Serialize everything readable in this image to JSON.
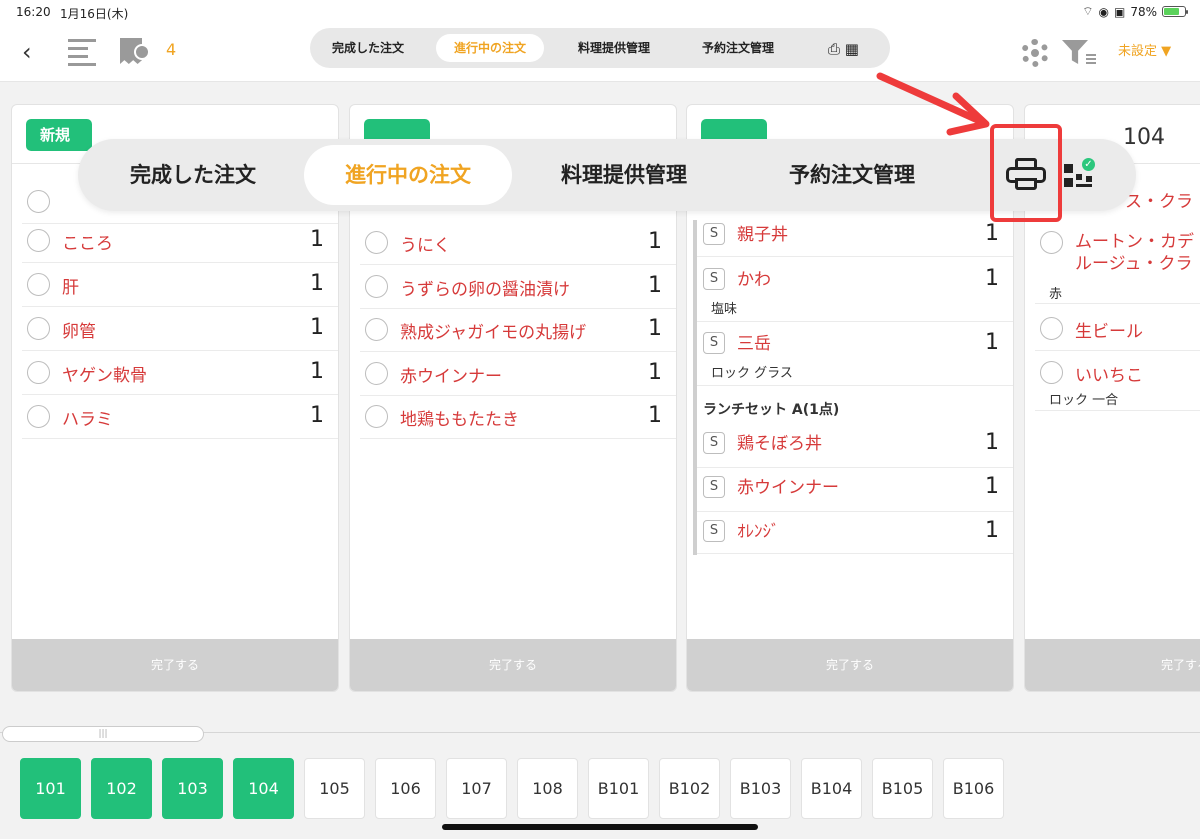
{
  "status": {
    "time": "16:20",
    "date": "1月16日(木)",
    "battery": "78%"
  },
  "header": {
    "back_icon": "chevron-left-icon",
    "badge_count": "4",
    "tabs": [
      "完成した注文",
      "進行中の注文",
      "料理提供管理",
      "予約注文管理"
    ],
    "active_tab": "進行中の注文",
    "unset_label": "未設定"
  },
  "overlay": {
    "tabs": [
      "完成した注文",
      "進行中の注文",
      "料理提供管理",
      "予約注文管理"
    ]
  },
  "columns": [
    {
      "badge": "新規",
      "items": [
        {
          "name": "こころ",
          "qty": "1"
        },
        {
          "name": "肝",
          "qty": "1"
        },
        {
          "name": "卵管",
          "qty": "1"
        },
        {
          "name": "ヤゲン軟骨",
          "qty": "1"
        },
        {
          "name": "ハラミ",
          "qty": "1"
        }
      ],
      "done_label": "完了する"
    },
    {
      "items": [
        {
          "name": "うにく",
          "qty": "1"
        },
        {
          "name": "うずらの卵の醤油漬け",
          "qty": "1"
        },
        {
          "name": "熟成ジャガイモの丸揚げ",
          "qty": "1"
        },
        {
          "name": "赤ウインナー",
          "qty": "1"
        },
        {
          "name": "地鶏ももたたき",
          "qty": "1"
        }
      ],
      "done_label": "完了する"
    },
    {
      "items": [
        {
          "name": "親子丼",
          "qty": "1",
          "sub": ""
        },
        {
          "name": "かわ",
          "qty": "1",
          "sub": "塩味"
        },
        {
          "name": "三岳",
          "qty": "1",
          "sub": "ロック グラス"
        }
      ],
      "section": "ランチセット A(1点)",
      "set_items": [
        {
          "name": "鶏そぼろ丼",
          "qty": "1"
        },
        {
          "name": "赤ウインナー",
          "qty": "1"
        },
        {
          "name": "ｵﾚﾝｼﾞ",
          "qty": "1"
        }
      ],
      "s_label": "S",
      "done_label": "完了する"
    },
    {
      "table": "104",
      "items": [
        {
          "name": "ムートン・カデ ルージュ・クラ",
          "sub": "赤"
        },
        {
          "name": "生ビール",
          "sub": ""
        },
        {
          "name": "いいちこ",
          "sub": "ロック 一合"
        }
      ],
      "partial_top": "ス・クラ",
      "done_label": "完了する"
    }
  ],
  "tables": [
    "101",
    "102",
    "103",
    "104",
    "105",
    "106",
    "107",
    "108",
    "B101",
    "B102",
    "B103",
    "B104",
    "B105",
    "B106"
  ],
  "active_tables": [
    "101",
    "102",
    "103",
    "104"
  ],
  "colors": {
    "accent": "#f0a422",
    "green": "#22c07a",
    "red_text": "#d63a3a",
    "highlight": "#ee3b3b"
  }
}
